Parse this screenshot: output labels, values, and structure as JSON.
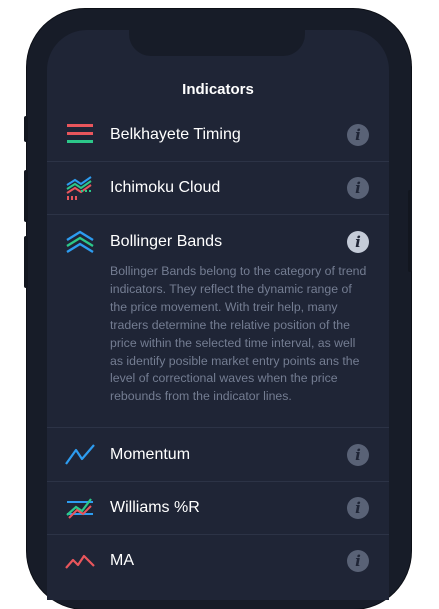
{
  "screen": {
    "title": "Indicators"
  },
  "indicators": [
    {
      "label": "Belkhayete Timing",
      "icon": "belkhayete-timing-icon"
    },
    {
      "label": "Ichimoku Cloud",
      "icon": "ichimoku-cloud-icon"
    },
    {
      "label": "Bollinger Bands",
      "icon": "bollinger-bands-icon",
      "expanded": true,
      "description": "Bollinger Bands belong to the category of trend indicators. They reflect the dynamic range of the price movement. With treir help, many traders determine the relative position of the price within the selected time interval, as well as identify posible market entry points ans the level of correctional waves when the price rebounds from the indicator lines."
    },
    {
      "label": "Momentum",
      "icon": "momentum-icon"
    },
    {
      "label": "Williams %R",
      "icon": "williams-r-icon"
    },
    {
      "label": "MA",
      "icon": "moving-average-icon"
    }
  ],
  "info_glyph": "i",
  "colors": {
    "background": "#1f2536",
    "red": "#e9565c",
    "green": "#2cc88a",
    "blue": "#2d9cf0",
    "info_inactive": "#596276",
    "info_active": "#c4cbd8"
  }
}
